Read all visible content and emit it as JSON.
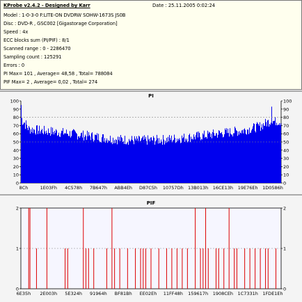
{
  "report": {
    "title": "KProbe v2.4.2 - Designed by Karr",
    "date": "Date : 25.11.2005 0:02:24",
    "lines": [
      "Model : 1-0-3-0 F:LITE-ON DVDRW SOHW-1673S JS0B",
      "Disc : DVD-R , GSC002 [Gigastorage Corporation]",
      "Speed : 4x",
      "ECC blocks sum (PI/PIF) : 8/1",
      "Scanned range : 0 - 2286470",
      "Sampling count : 125291",
      "Errors : 0",
      "PI Max= 101 , Average= 48,58 , Total= 788084",
      "PIF Max= 2 , Average= 0,02 , Total= 274"
    ]
  },
  "colors": {
    "pi": "#0000ee",
    "pif": "#dd0000",
    "grid": "#888888",
    "bg": "#f4f4f4"
  },
  "chart_data": [
    {
      "type": "bar",
      "title": "PI",
      "ylim": [
        0,
        100
      ],
      "yticks": [
        0,
        10,
        20,
        30,
        40,
        50,
        60,
        70,
        80,
        90,
        100
      ],
      "x_ticklabels": [
        "8Ch",
        "1E03Fh",
        "4C578h",
        "7B647h",
        "ABB4Eh",
        "D87C5h",
        "10757Dh",
        "13B013h",
        "16CE13h",
        "19E76Eh",
        "1D0586h"
      ],
      "dashed_gridlines": [
        50,
        80
      ],
      "envelope": {
        "x": [
          0,
          0.03,
          0.08,
          0.15,
          0.25,
          0.35,
          0.45,
          0.55,
          0.65,
          0.75,
          0.85,
          0.92,
          0.96,
          1.0
        ],
        "top": [
          88,
          72,
          70,
          68,
          64,
          60,
          58,
          59,
          62,
          66,
          70,
          75,
          82,
          80
        ],
        "bottom": [
          50,
          44,
          42,
          40,
          36,
          32,
          30,
          31,
          34,
          38,
          42,
          48,
          54,
          56
        ]
      },
      "spikes": [
        {
          "x": 0.0,
          "y": 95
        },
        {
          "x": 0.965,
          "y": 93
        }
      ]
    },
    {
      "type": "bar",
      "title": "PIF",
      "ylim": [
        0,
        2
      ],
      "yticks": [
        0,
        1,
        2
      ],
      "x_ticklabels": [
        "6E35h",
        "2E003h",
        "5E324h",
        "91964h",
        "BF81Bh",
        "EE02Eh",
        "11FF48h",
        "159617h",
        "1908CEh",
        "1C7331h",
        "1FDE1Eh"
      ],
      "dashed_gridlines": [
        1
      ],
      "bars_x": [
        0.03,
        0.035,
        0.06,
        0.1,
        0.17,
        0.18,
        0.24,
        0.25,
        0.26,
        0.28,
        0.33,
        0.35,
        0.36,
        0.38,
        0.41,
        0.44,
        0.46,
        0.47,
        0.48,
        0.5,
        0.53,
        0.56,
        0.58,
        0.6,
        0.62,
        0.64,
        0.67,
        0.69,
        0.7,
        0.71,
        0.72,
        0.75,
        0.76,
        0.78,
        0.8,
        0.82,
        0.83,
        0.86,
        0.88,
        0.9,
        0.92,
        0.94,
        0.95,
        0.98
      ],
      "bars_y": [
        2,
        2,
        1,
        2,
        1,
        1,
        2,
        1,
        1,
        1,
        1,
        2,
        1,
        1,
        1,
        1,
        1,
        1,
        1,
        1,
        1,
        1,
        1,
        1,
        1,
        1,
        2,
        1,
        1,
        2,
        1,
        1,
        1,
        1,
        2,
        1,
        1,
        1,
        1,
        1,
        1,
        1,
        1,
        1
      ]
    }
  ]
}
